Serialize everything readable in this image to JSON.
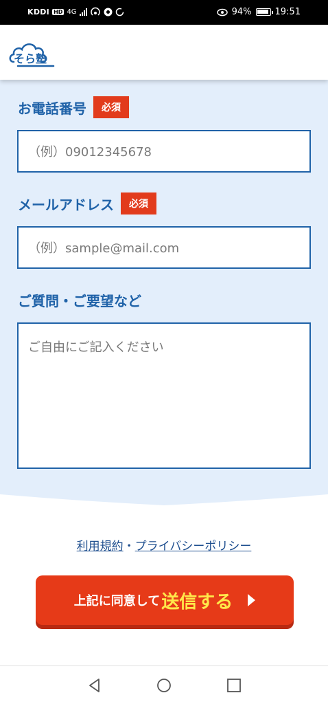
{
  "status_bar": {
    "carrier": "KDDI",
    "hd": "HD",
    "network": "4G",
    "battery": "94%",
    "time": "19:51"
  },
  "header": {
    "logo_text": "そら塾",
    "brand_color": "#1f62a8"
  },
  "form": {
    "phone": {
      "label": "お電話番号",
      "required": "必須",
      "placeholder": "（例）09012345678"
    },
    "email": {
      "label": "メールアドレス",
      "required": "必須",
      "placeholder": "（例）sample@mail.com"
    },
    "questions": {
      "label": "ご質問・ご要望など",
      "placeholder": "ご自由にご記入ください"
    }
  },
  "footer": {
    "terms_link": "利用規約",
    "separator": "・",
    "privacy_link": "プライバシーポリシー",
    "submit_prefix": "上記に同意して",
    "submit_main": "送信する"
  },
  "colors": {
    "accent": "#1f62a8",
    "required_badge": "#e23b1c",
    "submit_button": "#e63a18",
    "submit_highlight": "#ffe84a",
    "form_background": "#e3eefb"
  },
  "icons": {
    "nav_back": "triangle-back-icon",
    "nav_home": "circle-home-icon",
    "nav_recents": "square-recents-icon"
  }
}
